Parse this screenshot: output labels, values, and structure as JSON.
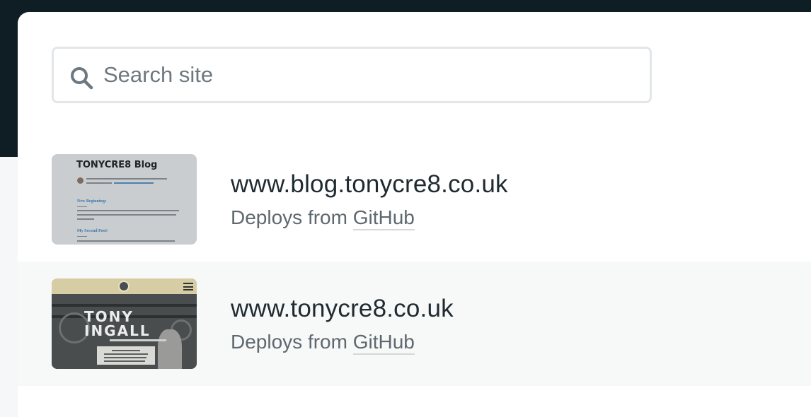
{
  "search": {
    "placeholder": "Search site",
    "value": ""
  },
  "sites": [
    {
      "name": "www.blog.tonycre8.co.uk",
      "deploy_prefix": "Deploys from",
      "deploy_source": "GitHub",
      "thumbnail": {
        "title": "TONYCRE8 Blog",
        "post_1_title": "New Beginnings",
        "post_2_title": "My Second Post!"
      }
    },
    {
      "name": "www.tonycre8.co.uk",
      "deploy_prefix": "Deploys from",
      "deploy_source": "GitHub",
      "thumbnail": {
        "heading_line_1": "TONY",
        "heading_line_2": "INGALL"
      }
    }
  ],
  "icons": {
    "search": "search-icon",
    "menu": "hamburger-menu-icon"
  },
  "colors": {
    "header_background": "#0f1d25",
    "panel_background": "#ffffff",
    "alt_row_background": "#f7f8f8",
    "site_name": "#1f2a31",
    "secondary_text": "#5e686f"
  }
}
